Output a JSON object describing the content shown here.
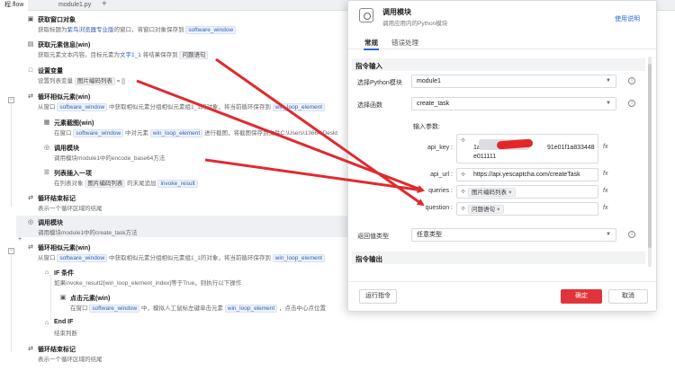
{
  "tabs": [
    {
      "label": "程.flow"
    },
    {
      "label": "module1.py"
    }
  ],
  "tab_plus": "+",
  "steps": {
    "s1": {
      "title": "获取窗口对象",
      "d1": "获取标题为",
      "d2": "紫鸟浏览器专业版",
      "d3": "的窗口，将窗口对象保存到",
      "d4": "software_window"
    },
    "s2": {
      "title": "获取元素信息(win)",
      "d1": "获取元素文本内容。目标元素为",
      "d2": "文字1_1",
      "d3": "将结果保存到",
      "d4": "问题语句"
    },
    "s3": {
      "title": "设置变量",
      "d1": "设置列表变量",
      "d2": "图片编码列表",
      "d3": "= []"
    },
    "s4": {
      "title": "循环相似元素(win)",
      "d1": "从窗口",
      "d2": "software_window",
      "d3": "中获取相似元素分组相似元素组1_1的对象，将当前循环保存到",
      "d4": "win_loop_element"
    },
    "s5": {
      "title": "元素截图(win)",
      "d1": "在窗口",
      "d2": "software_window",
      "d3": "中对元素",
      "d4": "win_loop_element",
      "d5": "进行截图，将截图保存到文件C:\\Users\\13664\\Deskt"
    },
    "s6": {
      "title": "调用模块",
      "d1": "调用模块module1中的encode_base64方法"
    },
    "s7": {
      "title": "列表插入一项",
      "d1": "在列表对象",
      "d2": "图片编码列表",
      "d3": "的末尾追加",
      "d4": "invoke_result"
    },
    "s8": {
      "title": "循环结束标记",
      "d1": "表示一个循环区域的结尾"
    },
    "s9": {
      "title": "调用模块",
      "d1": "调用模块module1中的create_task方法"
    },
    "s10": {
      "title": "循环相似元素(win)",
      "d1": "从窗口",
      "d2": "software_window",
      "d3": "中获取相似元素分组相似元素组1_1的对象，将当前循环保存到",
      "d4": "win_loop_element"
    },
    "s11": {
      "title": "IF 条件",
      "d1": "如果invoke_result2[win_loop_element_index]等于True，则执行以下操作"
    },
    "s12": {
      "title": "点击元素(win)",
      "d1": "在窗口",
      "d2": "software_window",
      "d3": "中，模拟人工鼠标左键单击元素",
      "d4": "win_loop_element",
      "d5": "，点击中心点位置"
    },
    "s13": {
      "title": "End IF",
      "d1": "结束判断"
    },
    "s14": {
      "title": "循环结束标记",
      "d1": "表示一个循环区域的结尾"
    }
  },
  "dialog": {
    "title": "调用模块",
    "subtitle": "调用应用内的Python模块",
    "help": "使用说明",
    "tab_general": "常规",
    "tab_error": "错误处理",
    "section_input": "指令输入",
    "label_module": "选择Python模块",
    "module_value": "module1",
    "label_function": "选择函数",
    "function_value": "create_task",
    "params_label": "输入参数:",
    "api_key_label": "api_key :",
    "api_key_value_1": "1a0e70",
    "api_key_value_2": "91e01f1a833448",
    "api_key_value_3": "e011111",
    "api_url_label": "api_url :",
    "api_url_value": "https://api.yescaptcha.com/createTask",
    "queries_label": "queries :",
    "queries_chip": "图片编码列表",
    "question_label": "question :",
    "question_chip": "问题语句",
    "label_return": "返回值类型",
    "return_value": "任意类型",
    "section_output": "指令输出",
    "btn_run": "运行指令",
    "btn_ok": "确定",
    "btn_cancel": "取消",
    "fx": "fx",
    "chip_x": "×",
    "info": "i",
    "drag": "✣",
    "caret": "▼"
  },
  "colors": {
    "accent": "#2f66d0",
    "confirm": "#e0343a",
    "arrow": "#e02a2f"
  }
}
